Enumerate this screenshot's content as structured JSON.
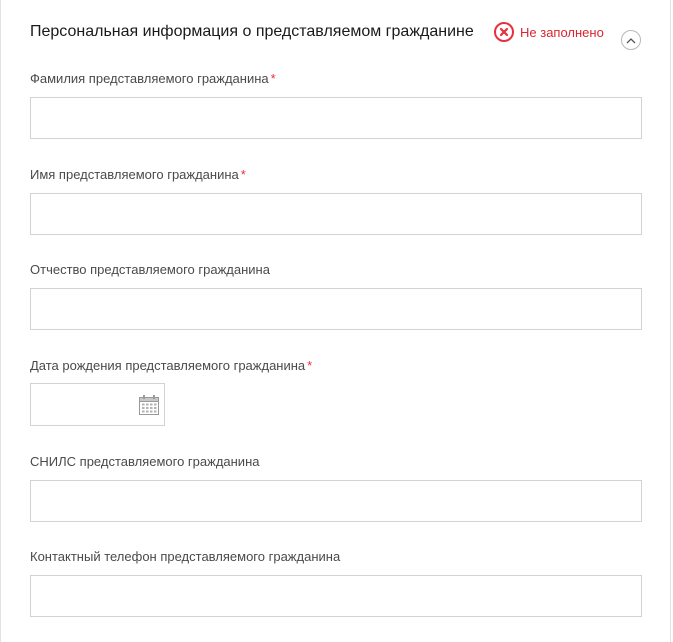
{
  "section": {
    "title": "Персональная информация о представляемом гражданине",
    "status_text": "Не заполнено",
    "status_icon": "error-x-icon",
    "collapse_icon": "chevron-up-icon",
    "status_color": "#e8303d"
  },
  "fields": {
    "last_name": {
      "label": "Фамилия представляемого гражданина",
      "required_mark": "*",
      "value": ""
    },
    "first_name": {
      "label": "Имя представляемого гражданина",
      "required_mark": "*",
      "value": ""
    },
    "patronymic": {
      "label": "Отчество представляемого гражданина",
      "value": ""
    },
    "birth_date": {
      "label": "Дата рождения представляемого гражданина",
      "required_mark": "*",
      "value": "",
      "icon": "calendar-icon"
    },
    "snils": {
      "label": "СНИЛС представляемого гражданина",
      "value": ""
    },
    "phone": {
      "label": "Контактный телефон представляемого гражданина",
      "value": ""
    }
  }
}
